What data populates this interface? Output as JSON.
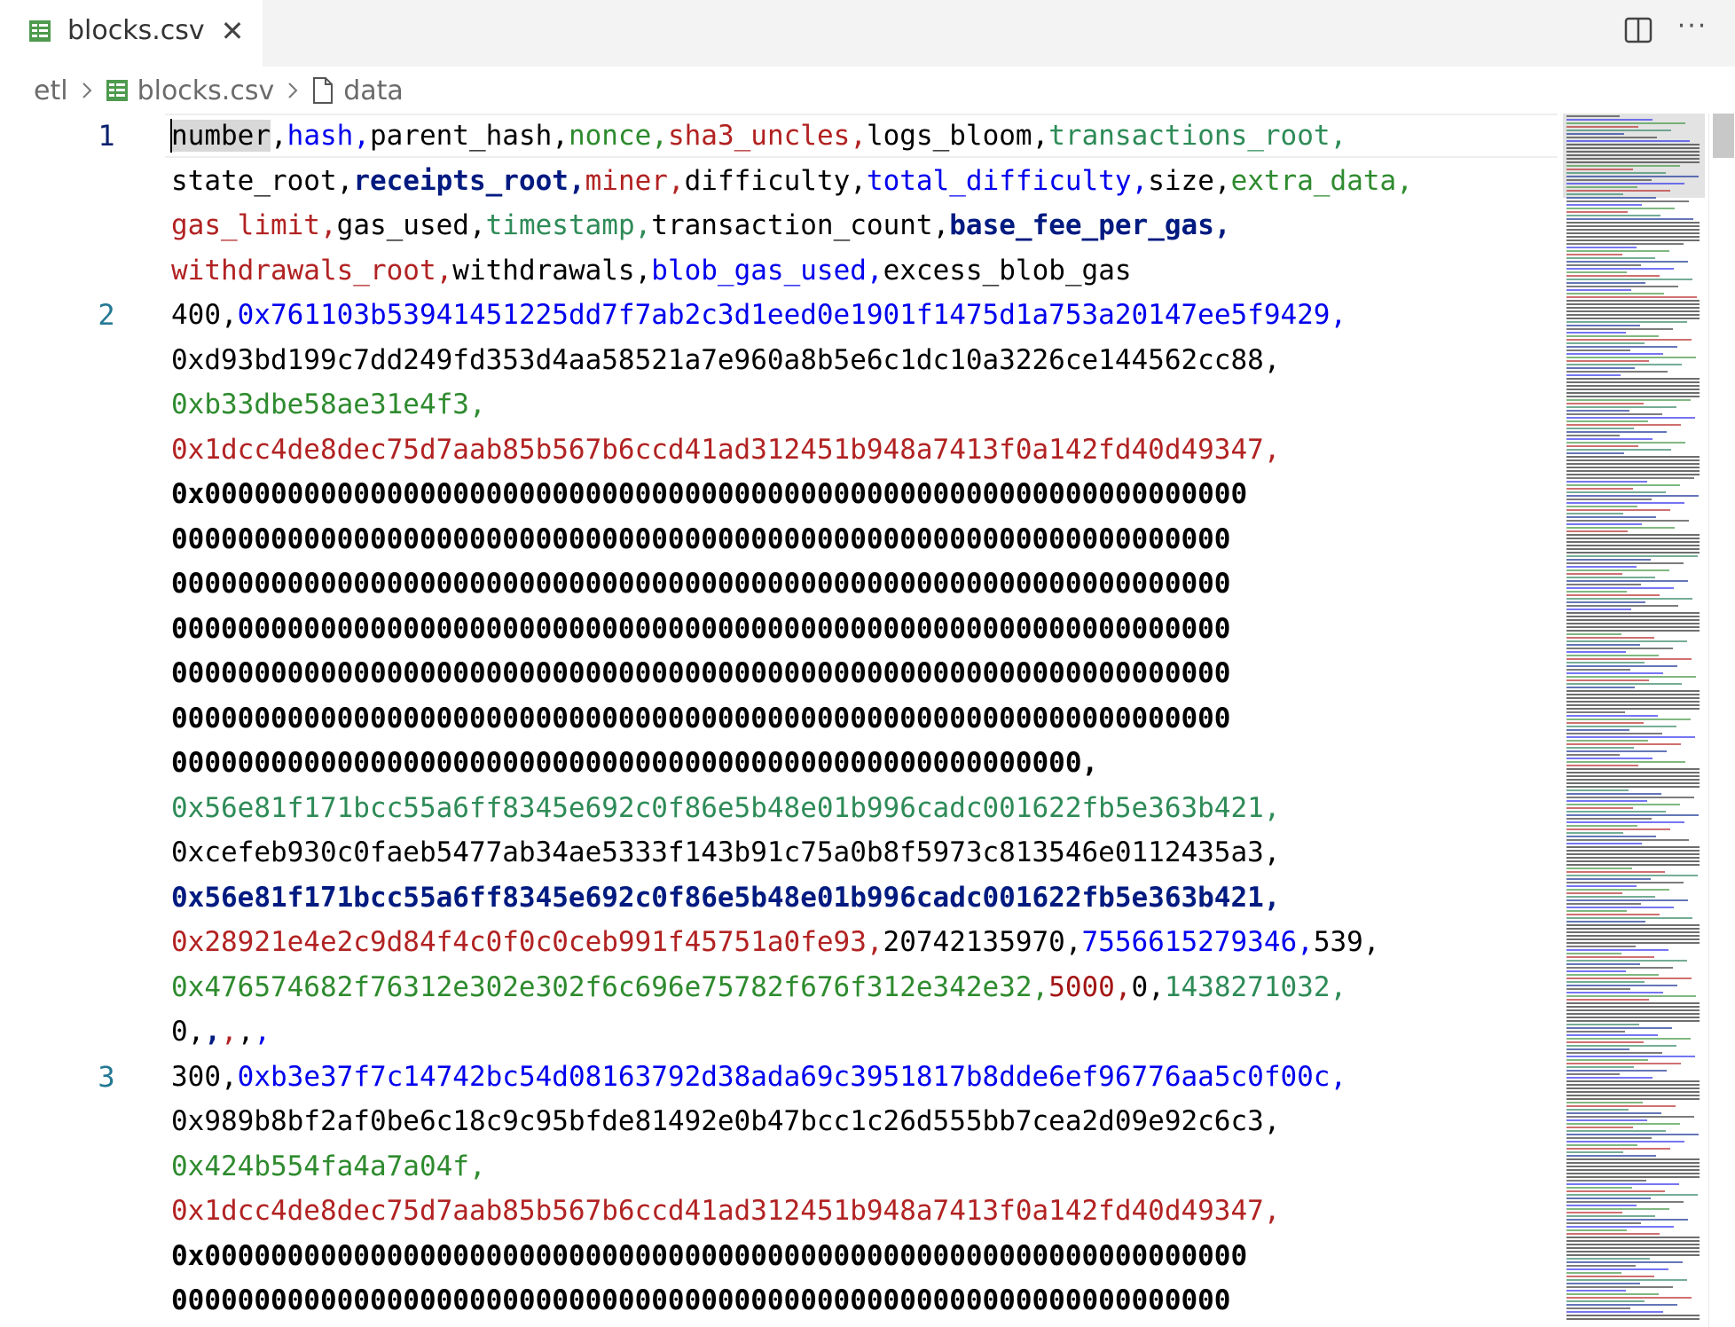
{
  "tab": {
    "label": "blocks.csv"
  },
  "breadcrumb": {
    "root": "etl",
    "file": "blocks.csv",
    "symbol": "data"
  },
  "line_numbers": [
    "1",
    "2",
    "3"
  ],
  "lines": [
    [
      [
        "number",
        "c0"
      ],
      [
        ",",
        "c0"
      ],
      [
        "hash",
        "c1"
      ],
      [
        ",",
        "c1"
      ],
      [
        "parent_hash",
        "c2"
      ],
      [
        ",",
        "c2"
      ],
      [
        "nonce",
        "c3"
      ],
      [
        ",",
        "c3"
      ],
      [
        "sha3_uncles",
        "c4"
      ],
      [
        ",",
        "c4"
      ],
      [
        "logs_bloom",
        "c5"
      ],
      [
        ",",
        "c5"
      ],
      [
        "transactions_root",
        "c6"
      ],
      [
        ",",
        "c6"
      ]
    ],
    [
      [
        "state_root",
        "c7"
      ],
      [
        ",",
        "c7"
      ],
      [
        "receipts_root",
        "c8"
      ],
      [
        ",",
        "c8"
      ],
      [
        "miner",
        "c4"
      ],
      [
        ",",
        "c4"
      ],
      [
        "difficulty",
        "c0"
      ],
      [
        ",",
        "c0"
      ],
      [
        "total_difficulty",
        "c1"
      ],
      [
        ",",
        "c1"
      ],
      [
        "size",
        "c2"
      ],
      [
        ",",
        "c2"
      ],
      [
        "extra_data",
        "c3"
      ],
      [
        ",",
        "c3"
      ]
    ],
    [
      [
        "gas_limit",
        "c4"
      ],
      [
        ",",
        "c4"
      ],
      [
        "gas_used",
        "c5"
      ],
      [
        ",",
        "c5"
      ],
      [
        "timestamp",
        "c6"
      ],
      [
        ",",
        "c6"
      ],
      [
        "transaction_count",
        "c7"
      ],
      [
        ",",
        "c7"
      ],
      [
        "base_fee_per_gas",
        "c8"
      ],
      [
        ",",
        "c8"
      ]
    ],
    [
      [
        "withdrawals_root",
        "c4"
      ],
      [
        ",",
        "c4"
      ],
      [
        "withdrawals",
        "c0"
      ],
      [
        ",",
        "c0"
      ],
      [
        "blob_gas_used",
        "c1"
      ],
      [
        ",",
        "c1"
      ],
      [
        "excess_blob_gas",
        "c2"
      ]
    ],
    [
      [
        "400",
        "c0"
      ],
      [
        ",",
        "c0"
      ],
      [
        "0x761103b53941451225dd7f7ab2c3d1eed0e1901f1475d1a753a20147ee5f9429",
        "c1"
      ],
      [
        ",",
        "c1"
      ]
    ],
    [
      [
        "0xd93bd199c7dd249fd353d4aa58521a7e960a8b5e6c1dc10a3226ce144562cc88",
        "c2"
      ],
      [
        ",",
        "c2"
      ]
    ],
    [
      [
        "0xb33dbe58ae31e4f3",
        "c3"
      ],
      [
        ",",
        "c3"
      ]
    ],
    [
      [
        "0x1dcc4de8dec75d7aab85b567b6ccd41ad312451b948a7413f0a142fd40d49347",
        "c4"
      ],
      [
        ",",
        "c4"
      ]
    ],
    [
      [
        "0x000000000000000000000000000000000000000000000000000000000000000",
        "c5b"
      ]
    ],
    [
      [
        "0000000000000000000000000000000000000000000000000000000000000000",
        "c5b"
      ]
    ],
    [
      [
        "0000000000000000000000000000000000000000000000000000000000000000",
        "c5b"
      ]
    ],
    [
      [
        "0000000000000000000000000000000000000000000000000000000000000000",
        "c5b"
      ]
    ],
    [
      [
        "0000000000000000000000000000000000000000000000000000000000000000",
        "c5b"
      ]
    ],
    [
      [
        "0000000000000000000000000000000000000000000000000000000000000000",
        "c5b"
      ]
    ],
    [
      [
        "0000000000000000000000000000000000000000000000000000000",
        "c5b"
      ],
      [
        ",",
        "c5b"
      ]
    ],
    [
      [
        "0x56e81f171bcc55a6ff8345e692c0f86e5b48e01b996cadc001622fb5e363b421",
        "c6"
      ],
      [
        ",",
        "c6"
      ]
    ],
    [
      [
        "0xcefeb930c0faeb5477ab34ae5333f143b91c75a0b8f5973c813546e0112435a3",
        "c7"
      ],
      [
        ",",
        "c7"
      ]
    ],
    [
      [
        "0x56e81f171bcc55a6ff8345e692c0f86e5b48e01b996cadc001622fb5e363b421",
        "c8"
      ],
      [
        ",",
        "c8"
      ]
    ],
    [
      [
        "0x28921e4e2c9d84f4c0f0c0ceb991f45751a0fe93",
        "c4"
      ],
      [
        ",",
        "c4"
      ],
      [
        "20742135970",
        "c0"
      ],
      [
        ",",
        "c0"
      ],
      [
        "7556615279346",
        "c1"
      ],
      [
        ",",
        "c1"
      ],
      [
        "539",
        "c2"
      ],
      [
        ",",
        "c2"
      ]
    ],
    [
      [
        "0x476574682f76312e302e302f6c696e75782f676f312e342e32",
        "c3"
      ],
      [
        ",",
        "c3"
      ],
      [
        "5000",
        "c9"
      ],
      [
        ",",
        "c9"
      ],
      [
        "0",
        "c5"
      ],
      [
        ",",
        "c5"
      ],
      [
        "1438271032",
        "c6"
      ],
      [
        ",",
        "c6"
      ]
    ],
    [
      [
        "0",
        "c7"
      ],
      [
        ",",
        "c7"
      ],
      [
        ",",
        "c8"
      ],
      [
        ",",
        "c4"
      ],
      [
        ",",
        "c0"
      ],
      [
        ",",
        "c1"
      ]
    ],
    [
      [
        "300",
        "c0"
      ],
      [
        ",",
        "c0"
      ],
      [
        "0xb3e37f7c14742bc54d08163792d38ada69c3951817b8dde6ef96776aa5c0f00c",
        "c1"
      ],
      [
        ",",
        "c1"
      ]
    ],
    [
      [
        "0x989b8bf2af0be6c18c9c95bfde81492e0b47bcc1c26d555bb7cea2d09e92c6c3",
        "c2"
      ],
      [
        ",",
        "c2"
      ]
    ],
    [
      [
        "0x424b554fa4a7a04f",
        "c3"
      ],
      [
        ",",
        "c3"
      ]
    ],
    [
      [
        "0x1dcc4de8dec75d7aab85b567b6ccd41ad312451b948a7413f0a142fd40d49347",
        "c4"
      ],
      [
        ",",
        "c4"
      ]
    ],
    [
      [
        "0x000000000000000000000000000000000000000000000000000000000000000",
        "c5b"
      ]
    ],
    [
      [
        "0000000000000000000000000000000000000000000000000000000000000000",
        "c5b"
      ]
    ]
  ],
  "colors": {
    "accent_tab_icon": "#4e9a4e",
    "line_number": "#237893",
    "active_line_number": "#0b216f",
    "rainbow_columns": [
      "#000000",
      "#0000ee",
      "#2e8b2e",
      "#b22222",
      "#2e8b57",
      "#001a80"
    ]
  }
}
